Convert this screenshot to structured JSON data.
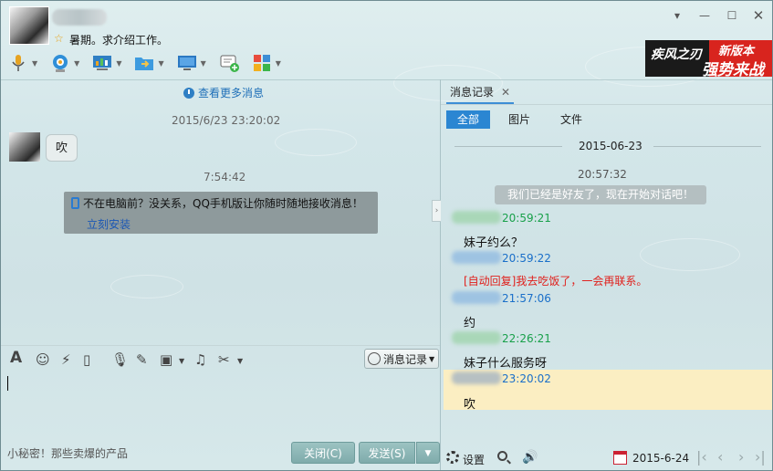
{
  "header": {
    "signature": "暑期。求介绍工作。",
    "window_controls": [
      "menu",
      "minimize",
      "maximize",
      "close"
    ]
  },
  "toolbar": {
    "items": [
      "voice-call-icon",
      "video-call-icon",
      "screen-share-icon",
      "file-transfer-icon",
      "remote-assist-icon",
      "add-chat-icon",
      "apps-icon"
    ]
  },
  "ad": {
    "brand": "疾风之刃",
    "line1": "新版本",
    "line2": "强势来战"
  },
  "chat": {
    "more_messages": "查看更多消息",
    "timestamp1": "2015/6/23 23:20:02",
    "bubble_text": "吹",
    "timestamp2": "7:54:42",
    "notice_text": "不在电脑前？没关系，QQ手机版让你随时随地接收消息！",
    "notice_link": "立刻安装"
  },
  "input": {
    "history_button": "消息记录",
    "tip": "小秘密！那些卖爆的产品",
    "close_button": "关闭(C)",
    "send_button": "发送(S)"
  },
  "history": {
    "tab_label": "消息记录",
    "filters": [
      "全部",
      "图片",
      "文件"
    ],
    "date": "2015-06-23",
    "system_time": "20:57:32",
    "system_message": "我们已经是好友了，现在开始对话吧！",
    "entries": [
      {
        "time": "20:59:21",
        "text": "妹子约么？",
        "color": "#18a04a"
      },
      {
        "time": "20:59:22",
        "text": "[自动回复]我去吃饭了，一会再联系。",
        "color": "#1a6fc9"
      },
      {
        "time": "21:57:06",
        "text": "约",
        "color": "#1a6fc9"
      },
      {
        "time": "22:26:21",
        "text": "妹子什么服务呀",
        "color": "#18a04a"
      },
      {
        "time": "23:20:02",
        "text": "吹",
        "color": "#1a6fc9"
      }
    ],
    "settings_label": "设置",
    "bottom_date": "2015-6-24"
  }
}
